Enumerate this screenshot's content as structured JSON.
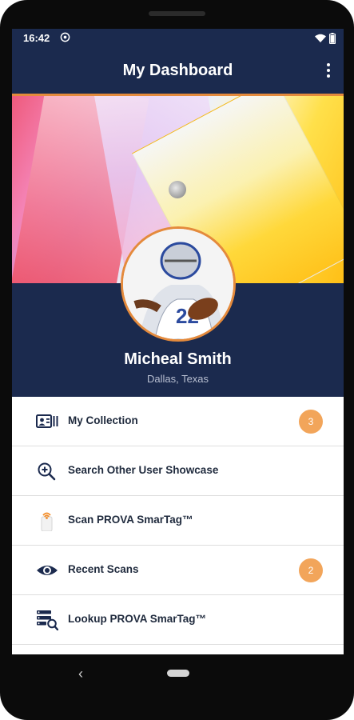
{
  "status_bar": {
    "time": "16:42"
  },
  "app_bar": {
    "title": "My Dashboard"
  },
  "profile": {
    "name": "Micheal Smith",
    "location": "Dallas, Texas",
    "jersey_number": "22"
  },
  "menu": {
    "items": [
      {
        "label": "My Collection",
        "icon": "collection-icon",
        "badge": "3"
      },
      {
        "label": "Search Other User Showcase",
        "icon": "zoom-search-icon"
      },
      {
        "label": "Scan PROVA SmarTag™",
        "icon": "nfc-scan-icon"
      },
      {
        "label": "Recent Scans",
        "icon": "eye-icon",
        "badge": "2"
      },
      {
        "label": "Lookup PROVA SmarTag™",
        "icon": "lookup-list-icon"
      }
    ]
  },
  "colors": {
    "navy": "#1b2a4e",
    "accent": "#e48a3c",
    "badge": "#f2a55a"
  }
}
